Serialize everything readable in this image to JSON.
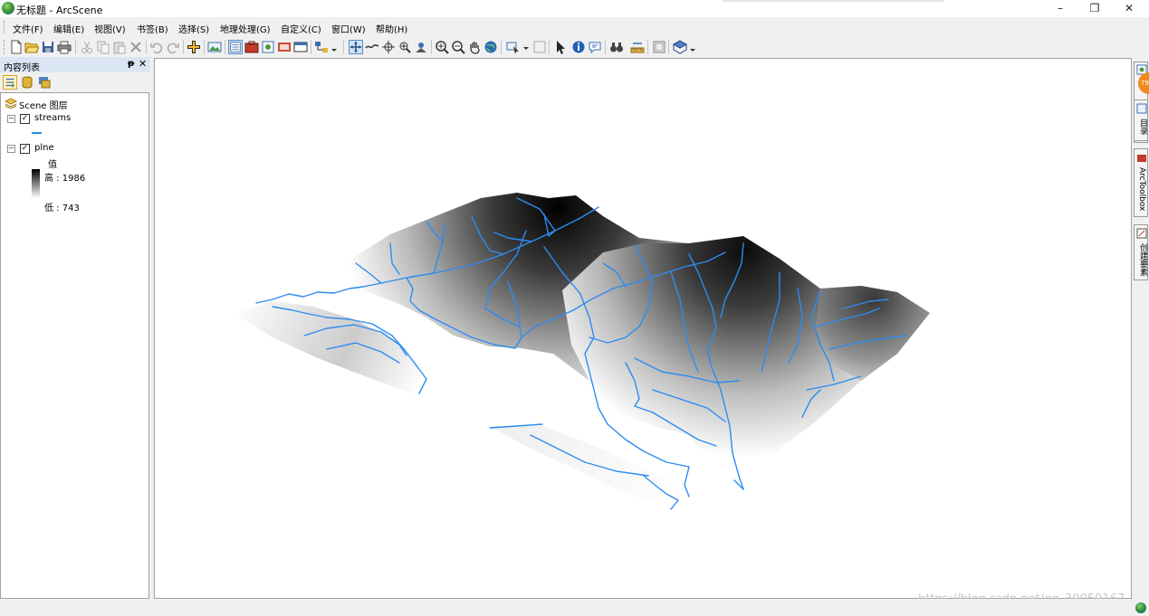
{
  "window": {
    "title": "无标题 - ArcScene",
    "minimize": "–",
    "maximize": "❐",
    "close": "✕"
  },
  "menu": {
    "file": "文件(F)",
    "edit": "编辑(E)",
    "view": "视图(V)",
    "bookmarks": "书签(B)",
    "selection": "选择(S)",
    "geoprocessing": "地理处理(G)",
    "customize": "自定义(C)",
    "windows": "窗口(W)",
    "help": "帮助(H)"
  },
  "toolbar_icons": [
    "new-document-icon",
    "open-folder-icon",
    "save-icon",
    "print-icon",
    "cut-icon",
    "copy-icon",
    "paste-icon",
    "delete-icon",
    "undo-icon",
    "redo-icon",
    "add-data-icon",
    "scene-properties-icon",
    "toc-window-icon",
    "arctoolbox-icon",
    "catalog-icon",
    "search-window-icon",
    "python-icon",
    "navigate-icon",
    "fly-icon",
    "center-target-icon",
    "zoom-to-target-icon",
    "set-observer-icon",
    "zoom-in-icon",
    "zoom-out-icon",
    "pan-icon",
    "full-extent-icon",
    "select-features-icon",
    "clear-selection-icon",
    "select-elements-icon",
    "identify-icon",
    "html-popup-icon",
    "find-icon",
    "measure-icon",
    "animation-icon",
    "3d-effects-icon"
  ],
  "toc": {
    "title": "内容列表",
    "pin": "ᵽ",
    "close": "✕",
    "tabs": [
      "list-by-drawing-order-icon",
      "list-by-source-icon",
      "list-by-visibility-icon"
    ],
    "scene_layers": "Scene 图层",
    "layers": [
      {
        "name": "streams",
        "checked": true,
        "symbol_color": "#1e8fe8"
      },
      {
        "name": "plne",
        "checked": true,
        "legend_title": "值",
        "high": "高 : 1986",
        "low": "低 : 743"
      }
    ]
  },
  "right_dock": {
    "tab1": "目录",
    "tab2": "ArcToolbox",
    "tab3": "创建要素",
    "badge": "79"
  },
  "colors": {
    "stream": "#2d8cf0",
    "terrain_high": "#000000",
    "terrain_low": "#ffffff",
    "toc_header": "#dbe6f4"
  },
  "scene": {
    "watermark": "https://blog.csdn.net/qq_39059167"
  }
}
